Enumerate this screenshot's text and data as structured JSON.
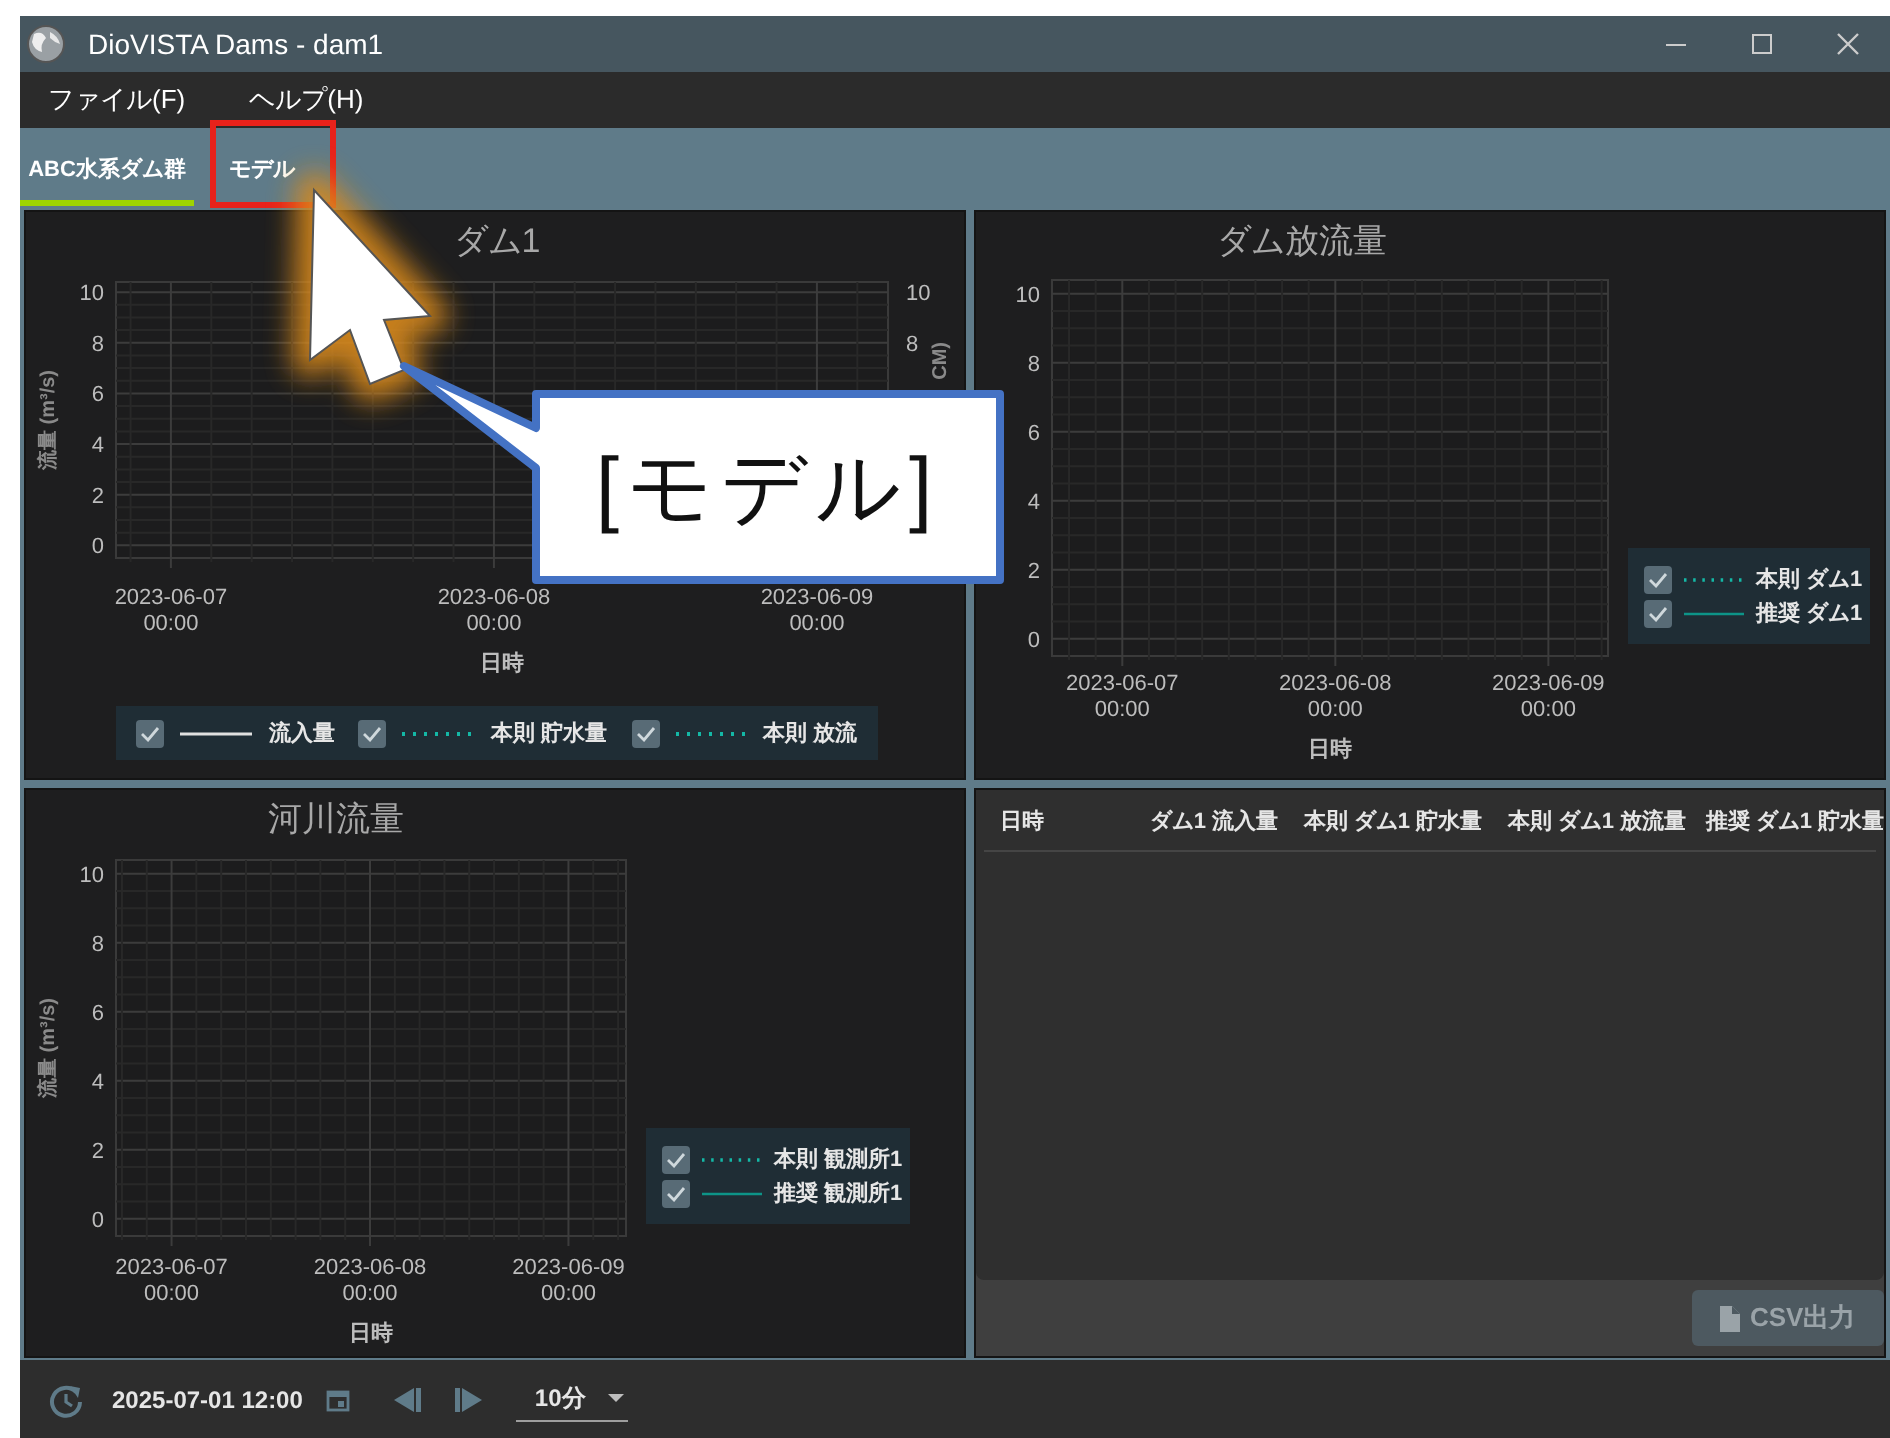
{
  "window": {
    "title": "DioVISTA Dams - dam1"
  },
  "menu": [
    "ファイル(F)",
    "ヘルプ(H)"
  ],
  "tabs": [
    {
      "label": "ABC水系ダム群",
      "selected": true
    },
    {
      "label": "モデル",
      "selected": false
    }
  ],
  "charts": [
    {
      "title": "ダム1",
      "chart_data": {
        "type": "line",
        "xlabel": "日時",
        "ylabel": "流量 (m³/s)",
        "grid": true,
        "ylim": [
          -0.5,
          10.4
        ],
        "yticks": [
          0,
          2,
          4,
          6,
          8,
          10
        ],
        "categories": [
          "2023-06-07 00:00",
          "2023-06-08 00:00",
          "2023-06-09 00:00"
        ]
      },
      "right_axis": {
        "label": "CM)",
        "ticks": [
          "10",
          "8"
        ]
      },
      "legend": [
        {
          "label": "流入量",
          "kind": "solid",
          "color": "#e0e0e0",
          "checked": true
        },
        {
          "label": "本則 貯水量",
          "kind": "dotted",
          "color": "#14b8a6",
          "checked": true
        },
        {
          "label": "本則 放流",
          "kind": "dotted",
          "color": "#14b8a6",
          "checked": true
        }
      ]
    },
    {
      "title": "ダム放流量",
      "chart_data": {
        "type": "line",
        "xlabel": "日時",
        "grid": true,
        "ylim": [
          -0.5,
          10.4
        ],
        "yticks": [
          0,
          2,
          4,
          6,
          8,
          10
        ],
        "categories": [
          "2023-06-07 00:00",
          "2023-06-08 00:00",
          "2023-06-09 00:00"
        ]
      },
      "legend": [
        {
          "label": "本則 ダム1",
          "kind": "dotted",
          "color": "#14b8a6",
          "checked": true
        },
        {
          "label": "推奨 ダム1",
          "kind": "solid",
          "color": "#0d9488",
          "checked": true
        }
      ]
    },
    {
      "title": "河川流量",
      "chart_data": {
        "type": "line",
        "xlabel": "日時",
        "ylabel": "流量 (m³/s)",
        "grid": true,
        "ylim": [
          -0.5,
          10.4
        ],
        "yticks": [
          0,
          2,
          4,
          6,
          8,
          10
        ],
        "categories": [
          "2023-06-07 00:00",
          "2023-06-08 00:00",
          "2023-06-09 00:00"
        ]
      },
      "legend": [
        {
          "label": "本則 観測所1",
          "kind": "dotted",
          "color": "#14b8a6",
          "checked": true
        },
        {
          "label": "推奨 観測所1",
          "kind": "solid",
          "color": "#0d9488",
          "checked": true
        }
      ]
    }
  ],
  "table": {
    "columns": [
      "日時",
      "ダム1 流入量",
      "本則 ダム1 貯水量",
      "本則 ダム1 放流量",
      "推奨 ダム1 貯水量"
    ]
  },
  "csv_button": {
    "label": "CSV出力",
    "disabled": true
  },
  "bottom_bar": {
    "datetime": "2025-07-01 12:00",
    "interval": "10分"
  },
  "annotation": {
    "callout": "[モデル]"
  }
}
